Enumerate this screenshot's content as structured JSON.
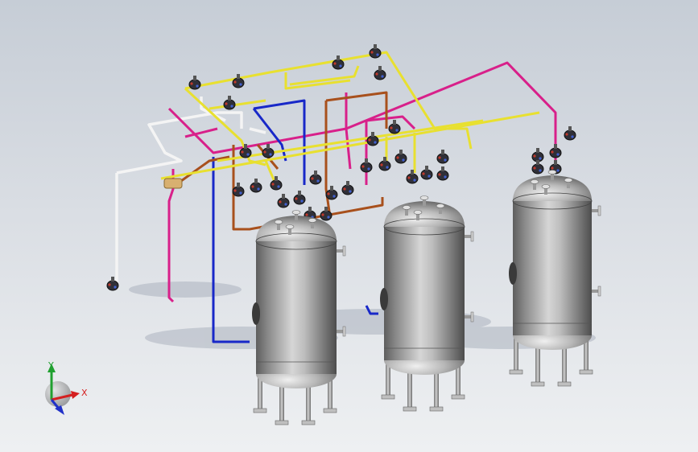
{
  "triad": {
    "x_label": "X",
    "y_label": "Y",
    "x_color": "#d42020",
    "y_color": "#20a030",
    "z_color": "#2030c8"
  },
  "pipes": {
    "yellow": "#e8e030",
    "white": "#f4f4f4",
    "magenta": "#d8208a",
    "blue": "#1828c8",
    "brown": "#a8501c",
    "tan": "#d8b070"
  },
  "tanks": [
    {
      "id": "tank-1"
    },
    {
      "id": "tank-2"
    },
    {
      "id": "tank-3"
    }
  ]
}
